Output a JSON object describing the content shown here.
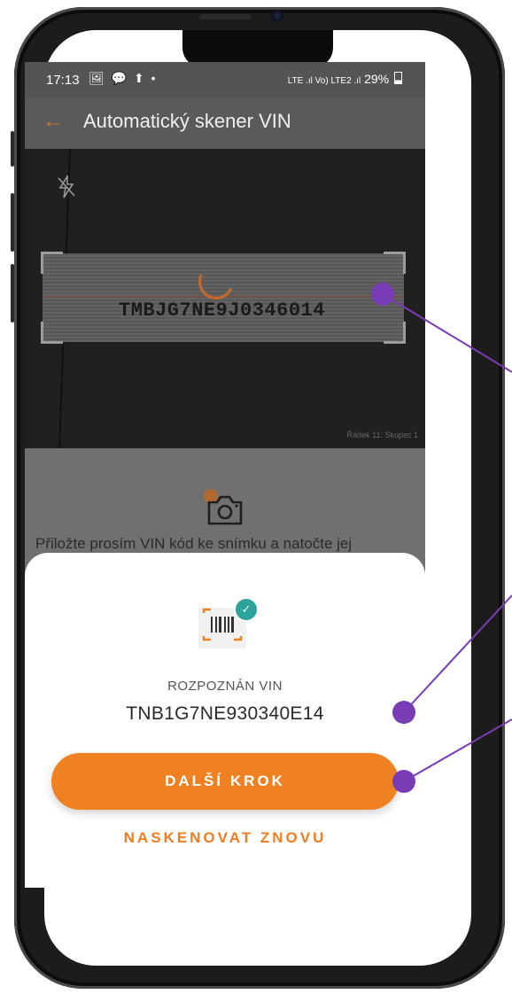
{
  "status_bar": {
    "time": "17:13",
    "left_icons": "🖼 💬 ⬆ •",
    "network": "LTE .ıl Vo) LTE2 .ıl",
    "battery": "29%"
  },
  "app_bar": {
    "back_icon": "arrow-left-icon",
    "title": "Automatický skener VIN"
  },
  "camera": {
    "flash_icon": "flash-off-icon",
    "detected_vin": "TMBJG7NE9J0346014",
    "row_label": "Řádek 11: Skupec 1"
  },
  "hint": {
    "camera_icon": "camera-icon",
    "text": "Přiložte prosím VIN kód ke snímku a natočte jej"
  },
  "result_sheet": {
    "vin_icon": "barcode-scan-icon",
    "check_icon": "check-icon",
    "label": "ROZPOZNÁN VIN",
    "vin": "TNB1G7NE930340E14",
    "next_button": "DALŠÍ KROK",
    "rescan_button": "NASKENOVAT ZNOVU"
  },
  "nav_bar": {
    "back": "‹",
    "home": "○",
    "recents": "|||"
  },
  "colors": {
    "accent": "#f08122",
    "annotation": "#7a3cb4",
    "badge": "#2ea39b"
  }
}
